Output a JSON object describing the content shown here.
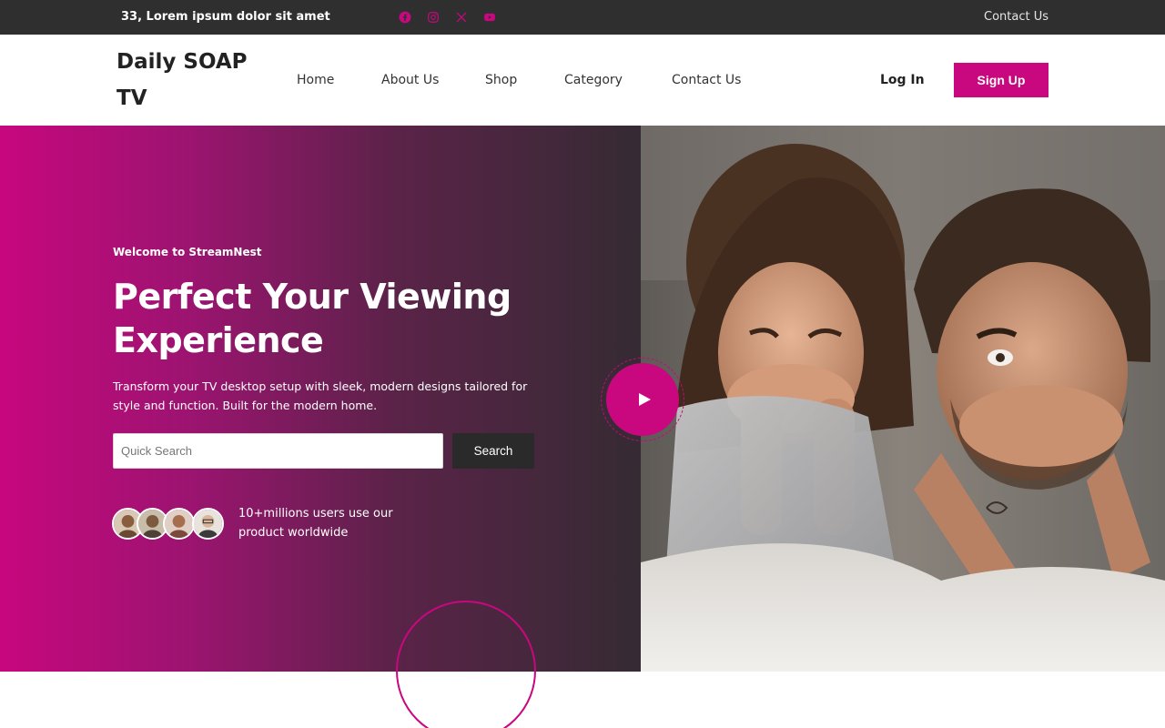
{
  "topbar": {
    "address": "33, Lorem ipsum dolor sit amet",
    "socials": [
      "facebook-icon",
      "instagram-icon",
      "x-twitter-icon",
      "youtube-icon"
    ],
    "contact": "Contact Us"
  },
  "header": {
    "logo": "Daily SOAP TV",
    "nav": [
      "Home",
      "About Us",
      "Shop",
      "Category",
      "Contact Us"
    ],
    "login": "Log In",
    "signup": "Sign Up"
  },
  "hero": {
    "welcome": "Welcome to StreamNest",
    "headline": "Perfect Your Viewing Experience",
    "description": "Transform your TV desktop setup with sleek, modern designs tailored for style and function. Built for the modern home.",
    "search_placeholder": "Quick Search",
    "search_button": "Search",
    "users_text": "10+millions users use our product worldwide",
    "play_icon": "play-icon"
  },
  "colors": {
    "accent": "#c9077f",
    "topbar": "#2f2f2f",
    "dark_button": "#2a2a2a"
  }
}
